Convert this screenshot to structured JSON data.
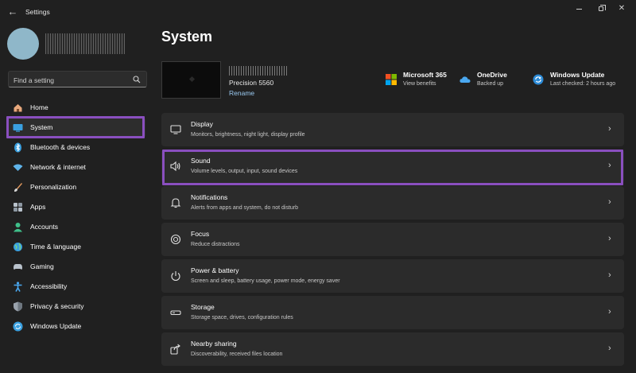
{
  "window": {
    "title": "Settings",
    "back_icon": "back-arrow-icon",
    "controls": [
      "minimize-icon",
      "maximize-icon",
      "close-icon"
    ]
  },
  "search": {
    "placeholder": "Find a setting",
    "icon": "search-icon"
  },
  "sidebar": {
    "items": [
      {
        "label": "Home",
        "icon": "home-icon",
        "color": "#e8a87c"
      },
      {
        "label": "System",
        "icon": "system-icon",
        "color": "#3aa0e0",
        "active": true
      },
      {
        "label": "Bluetooth & devices",
        "icon": "bluetooth-icon",
        "color": "#3aa0e0"
      },
      {
        "label": "Network & internet",
        "icon": "wifi-icon",
        "color": "#5fb4ea"
      },
      {
        "label": "Personalization",
        "icon": "brush-icon",
        "color": "#e39a5f"
      },
      {
        "label": "Apps",
        "icon": "apps-icon",
        "color": "#b9c2cc"
      },
      {
        "label": "Accounts",
        "icon": "accounts-icon",
        "color": "#3fbf8a"
      },
      {
        "label": "Time & language",
        "icon": "globe-icon",
        "color": "#3aa0e0"
      },
      {
        "label": "Gaming",
        "icon": "gaming-icon",
        "color": "#b9c2cc"
      },
      {
        "label": "Accessibility",
        "icon": "accessibility-icon",
        "color": "#4aa8f0"
      },
      {
        "label": "Privacy & security",
        "icon": "shield-icon",
        "color": "#9aa3ad"
      },
      {
        "label": "Windows Update",
        "icon": "update-icon",
        "color": "#3aa0e0"
      }
    ]
  },
  "page": {
    "title": "System",
    "device": {
      "model": "Precision 5560",
      "rename_label": "Rename"
    },
    "quick_links": [
      {
        "title": "Microsoft 365",
        "subtitle": "View benefits",
        "icon": "microsoft-logo-icon"
      },
      {
        "title": "OneDrive",
        "subtitle": "Backed up",
        "icon": "onedrive-cloud-icon"
      },
      {
        "title": "Windows Update",
        "subtitle": "Last checked: 2 hours ago",
        "icon": "windows-update-icon"
      }
    ],
    "cards": [
      {
        "title": "Display",
        "subtitle": "Monitors, brightness, night light, display profile",
        "icon": "display-icon"
      },
      {
        "title": "Sound",
        "subtitle": "Volume levels, output, input, sound devices",
        "icon": "speaker-icon"
      },
      {
        "title": "Notifications",
        "subtitle": "Alerts from apps and system, do not disturb",
        "icon": "bell-icon"
      },
      {
        "title": "Focus",
        "subtitle": "Reduce distractions",
        "icon": "focus-icon"
      },
      {
        "title": "Power & battery",
        "subtitle": "Screen and sleep, battery usage, power mode, energy saver",
        "icon": "power-icon"
      },
      {
        "title": "Storage",
        "subtitle": "Storage space, drives, configuration rules",
        "icon": "storage-icon"
      },
      {
        "title": "Nearby sharing",
        "subtitle": "Discoverability, received files location",
        "icon": "share-icon"
      }
    ]
  },
  "colors": {
    "background": "#202020",
    "card": "#2b2b2b",
    "highlight": "#8a4fbf",
    "link": "#99c9f0"
  }
}
